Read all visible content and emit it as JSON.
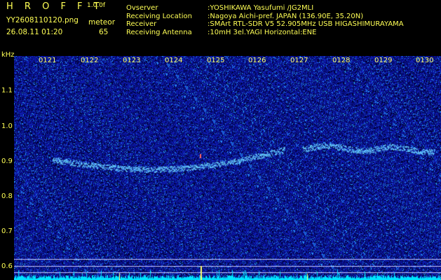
{
  "header": {
    "brand": "H R O F F T",
    "version": "1.0.0f",
    "filename": "YY2608110120.png",
    "datetime": "26.08.11 01:20",
    "mode_label": "meteor",
    "meteor_count": "65",
    "meta": [
      {
        "key": "Ovserver",
        "value": ":YOSHIKAWA Yasufumi /JG2MLI"
      },
      {
        "key": "Receiving Location",
        "value": ":Nagoya Aichi-pref. JAPAN (136.90E, 35.20N)"
      },
      {
        "key": "Receiver",
        "value": ":SMArt RTL-SDR V5 52.905MHz USB HIGASHIMURAYAMA"
      },
      {
        "key": "Receiving Antenna",
        "value": ":10mH 3el.YAGI Horizontal:ENE"
      }
    ]
  },
  "spectrogram": {
    "y_unit": "kHz",
    "y_ticks": [
      "1.1",
      "1.0",
      "0.9",
      "0.8",
      "0.7",
      "0.6"
    ],
    "x_ticks": [
      "0121",
      "0122",
      "0123",
      "0124",
      "0125",
      "0126",
      "0127",
      "0128",
      "0129",
      "0130"
    ],
    "colors": {
      "background": "#000080",
      "noise": "#1a3cff",
      "signal": "#66ccff",
      "level": "#00e5ff",
      "tick": "#ffff66"
    }
  }
}
